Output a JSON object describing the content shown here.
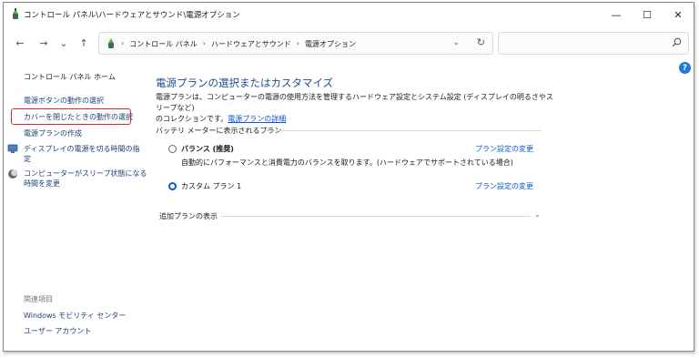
{
  "window": {
    "title": "コントロール パネル\\ハードウェアとサウンド\\電源オプション",
    "minimize": "—",
    "maximize": "☐",
    "close": "✕"
  },
  "nav": {
    "back": "←",
    "forward": "→",
    "recent": "⌄",
    "up": "↑",
    "breadcrumbs": [
      "コントロール パネル",
      "ハードウェアとサウンド",
      "電源オプション"
    ],
    "separator": "›",
    "dropdown": "⌄",
    "refresh": "↻",
    "search_placeholder": ""
  },
  "sidebar": {
    "home": "コントロール パネル ホーム",
    "items": [
      "電源ボタンの動作の選択",
      "カバーを閉じたときの動作の選択",
      "電源プランの作成",
      "ディスプレイの電源を切る時間の指",
      "定",
      "コンピューターがスリープ状態になる",
      "時間を変更"
    ],
    "related_title": "関連項目",
    "related": [
      "Windows モビリティ センター",
      "ユーザー アカウント"
    ]
  },
  "main": {
    "title": "電源プランの選択またはカスタマイズ",
    "desc_line1": "電源プランは、コンピューターの電源の使用方法を管理するハードウェア設定とシステム設定 (ディスプレイの明るさやスリープなど)",
    "desc_line2": "のコレクションです。",
    "desc_link": "電源プランの詳細",
    "section_title": "バッテリ メーターに表示されるプラン",
    "plans": [
      {
        "name": "バランス (推奨)",
        "desc": "自動的にパフォーマンスと消費電力のバランスを取ります。(ハードウェアでサポートされている場合)",
        "link": "プラン設定の変更",
        "selected": false
      },
      {
        "name": "カスタム プラン 1",
        "desc": "",
        "link": "プラン設定の変更",
        "selected": true
      }
    ],
    "more_plans": "追加プランの表示"
  },
  "help": "?",
  "colors": {
    "accent": "#0b57d0",
    "title": "#1e4e8c",
    "highlight": "#d42a2a"
  }
}
